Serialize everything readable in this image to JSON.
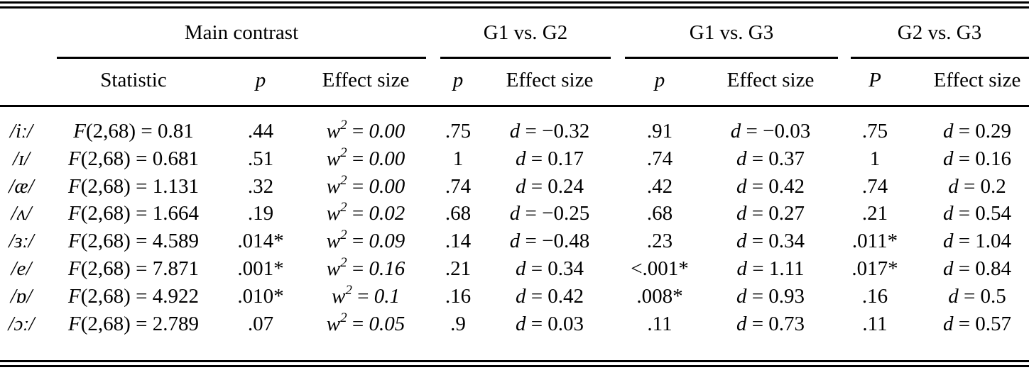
{
  "table": {
    "group_headers": [
      "Main contrast",
      "G1 vs. G2",
      "G1 vs. G3",
      "G2 vs. G3"
    ],
    "sub_headers": [
      "Statistic",
      "p",
      "Effect size",
      "p",
      "Effect size",
      "p",
      "Effect size",
      "P",
      "Effect size"
    ],
    "rows": [
      {
        "vowel": "/iː/",
        "statistic": "F(2,68) = 0.81",
        "p": ".44",
        "w2": "0.00",
        "g12_p": ".75",
        "g12_d": "d = −0.32",
        "g13_p": ".91",
        "g13_d": "d = −0.03",
        "g23_p": ".75",
        "g23_d": "d = 0.29"
      },
      {
        "vowel": "/ɪ/",
        "statistic": "F(2,68) = 0.681",
        "p": ".51",
        "w2": "0.00",
        "g12_p": "1",
        "g12_d": "d = 0.17",
        "g13_p": ".74",
        "g13_d": "d = 0.37",
        "g23_p": "1",
        "g23_d": "d = 0.16"
      },
      {
        "vowel": "/æ/",
        "statistic": "F(2,68) = 1.131",
        "p": ".32",
        "w2": "0.00",
        "g12_p": ".74",
        "g12_d": "d = 0.24",
        "g13_p": ".42",
        "g13_d": "d = 0.42",
        "g23_p": ".74",
        "g23_d": "d = 0.2"
      },
      {
        "vowel": "/ʌ/",
        "statistic": "F(2,68) = 1.664",
        "p": ".19",
        "w2": "0.02",
        "g12_p": ".68",
        "g12_d": "d = −0.25",
        "g13_p": ".68",
        "g13_d": "d = 0.27",
        "g23_p": ".21",
        "g23_d": "d = 0.54"
      },
      {
        "vowel": "/ɜː/",
        "statistic": "F(2,68) = 4.589",
        "p": ".014*",
        "w2": "0.09",
        "g12_p": ".14",
        "g12_d": "d = −0.48",
        "g13_p": ".23",
        "g13_d": "d = 0.34",
        "g23_p": ".011*",
        "g23_d": "d = 1.04"
      },
      {
        "vowel": "/e/",
        "statistic": "F(2,68) = 7.871",
        "p": ".001*",
        "w2": "0.16",
        "g12_p": ".21",
        "g12_d": "d = 0.34",
        "g13_p": "<.001*",
        "g13_d": "d = 1.11",
        "g23_p": ".017*",
        "g23_d": "d = 0.84"
      },
      {
        "vowel": "/ɒ/",
        "statistic": "F(2,68) = 4.922",
        "p": ".010*",
        "w2": "0.1",
        "g12_p": ".16",
        "g12_d": "d = 0.42",
        "g13_p": ".008*",
        "g13_d": "d = 0.93",
        "g23_p": ".16",
        "g23_d": "d = 0.5"
      },
      {
        "vowel": "/ɔː/",
        "statistic": "F(2,68) = 2.789",
        "p": ".07",
        "w2": "0.05",
        "g12_p": ".9",
        "g12_d": "d = 0.03",
        "g13_p": ".11",
        "g13_d": "d = 0.73",
        "g23_p": ".11",
        "g23_d": "d = 0.57"
      }
    ]
  }
}
